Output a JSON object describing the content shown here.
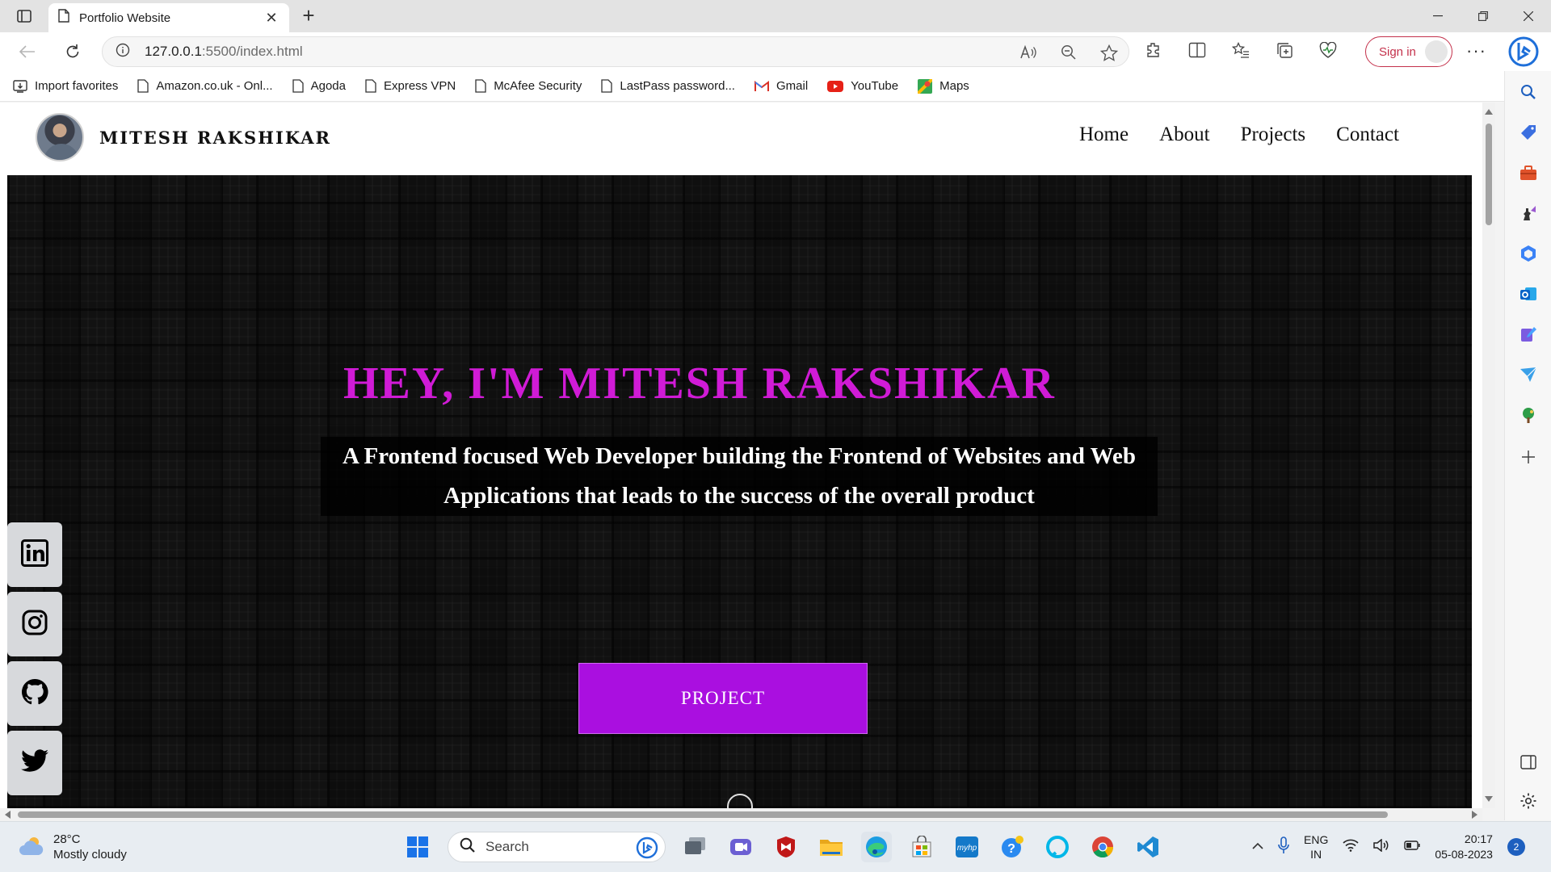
{
  "browser": {
    "tab_title": "Portfolio Website",
    "url_host": "127.0.0.1",
    "url_path": ":5500/index.html",
    "signin_label": "Sign in",
    "favorites": [
      {
        "label": "Import favorites",
        "icon": "import-icon"
      },
      {
        "label": "Amazon.co.uk - Onl...",
        "icon": "page-icon"
      },
      {
        "label": "Agoda",
        "icon": "page-icon"
      },
      {
        "label": "Express VPN",
        "icon": "page-icon"
      },
      {
        "label": "McAfee Security",
        "icon": "page-icon"
      },
      {
        "label": "LastPass password...",
        "icon": "page-icon"
      },
      {
        "label": "Gmail",
        "icon": "gmail-icon"
      },
      {
        "label": "YouTube",
        "icon": "youtube-icon"
      },
      {
        "label": "Maps",
        "icon": "maps-icon"
      }
    ]
  },
  "site": {
    "brand_name": "MITESH RAKSHIKAR",
    "nav": [
      "Home",
      "About",
      "Projects",
      "Contact"
    ],
    "hero_title": "HEY, I'M MITESH RAKSHIKAR",
    "hero_subtitle_line1": "A Frontend focused Web Developer building the Frontend of Websites and Web",
    "hero_subtitle_line2": "Applications that leads to the success of the overall product",
    "cta_label": "PROJECT",
    "socials": [
      "linkedin-icon",
      "instagram-icon",
      "github-icon",
      "twitter-icon"
    ]
  },
  "taskbar": {
    "temperature": "28°C",
    "weather": "Mostly cloudy",
    "search_placeholder": "Search",
    "lang_line1": "ENG",
    "lang_line2": "IN",
    "time": "20:17",
    "date": "05-08-2023",
    "notification_count": "2"
  },
  "colors": {
    "accent_magenta": "#d01bd6",
    "button_purple": "#aa0fe0",
    "signin_red": "#c4314b"
  }
}
